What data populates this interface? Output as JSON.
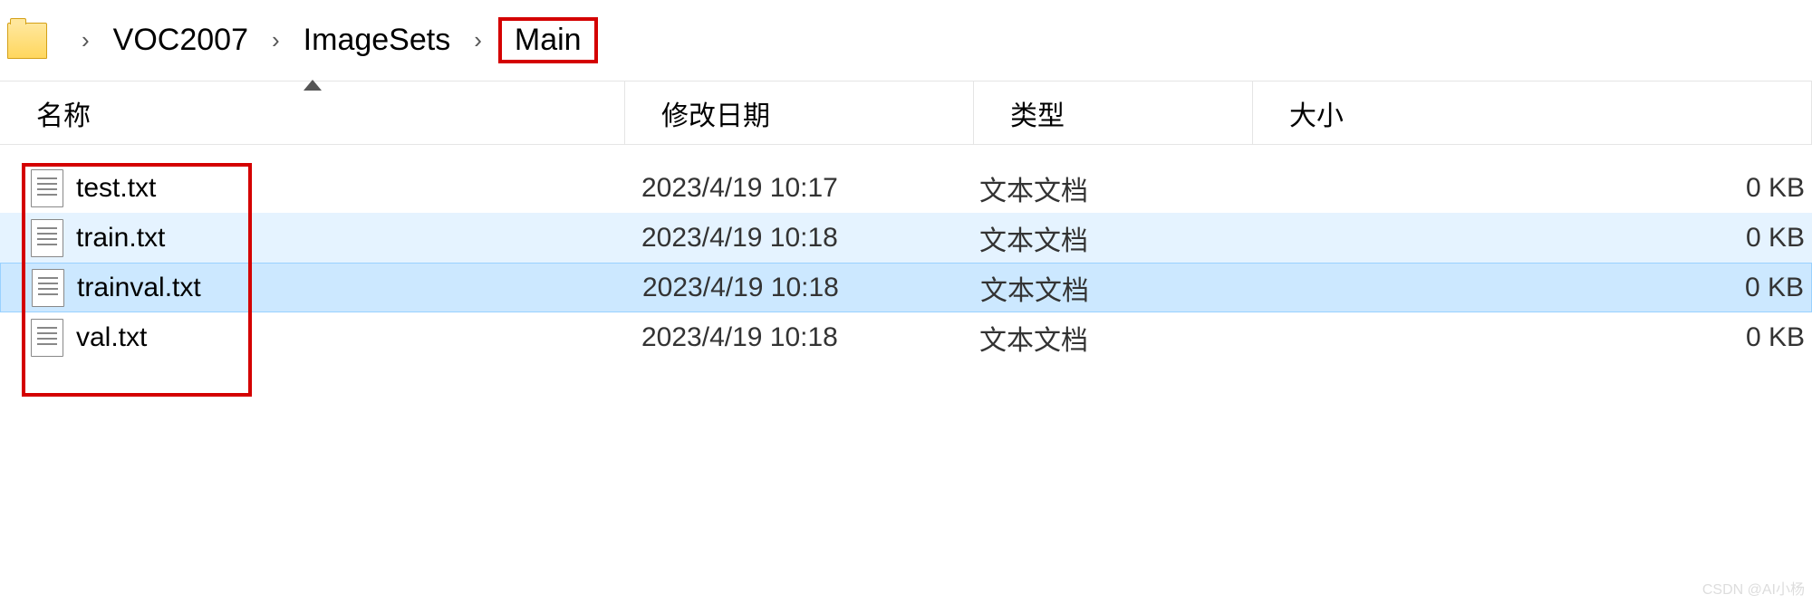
{
  "breadcrumb": {
    "items": [
      "VOC2007",
      "ImageSets",
      "Main"
    ],
    "highlighted_index": 2
  },
  "columns": {
    "name": "名称",
    "date": "修改日期",
    "type": "类型",
    "size": "大小"
  },
  "files": [
    {
      "name": "test.txt",
      "date": "2023/4/19 10:17",
      "type": "文本文档",
      "size": "0 KB",
      "state": ""
    },
    {
      "name": "train.txt",
      "date": "2023/4/19 10:18",
      "type": "文本文档",
      "size": "0 KB",
      "state": "highlighted"
    },
    {
      "name": "trainval.txt",
      "date": "2023/4/19 10:18",
      "type": "文本文档",
      "size": "0 KB",
      "state": "selected"
    },
    {
      "name": "val.txt",
      "date": "2023/4/19 10:18",
      "type": "文本文档",
      "size": "0 KB",
      "state": ""
    }
  ],
  "watermark": "CSDN @AI小杨"
}
